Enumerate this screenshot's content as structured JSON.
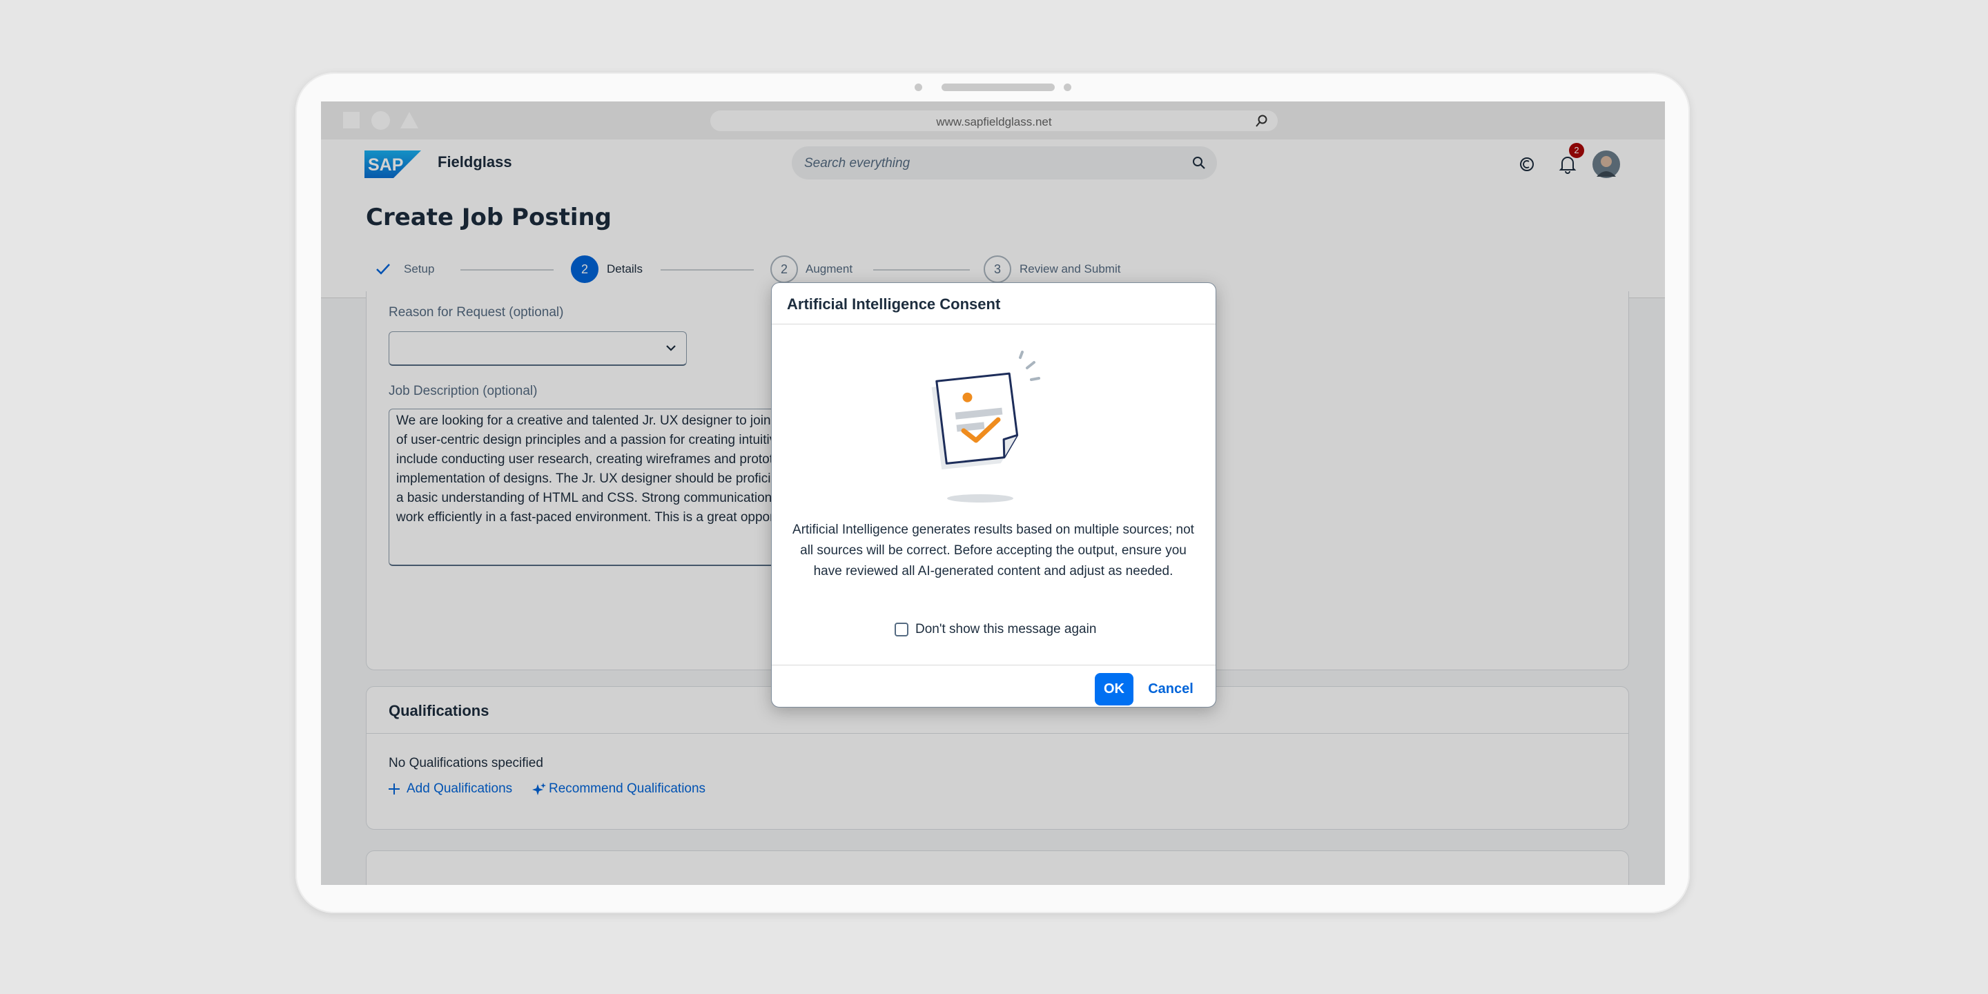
{
  "browser": {
    "url": "www.sapfieldglass.net"
  },
  "app": {
    "logo_text": "SAP",
    "name": "Fieldglass",
    "search_placeholder": "Search everything",
    "notification_count": "2"
  },
  "page": {
    "title": "Create Job Posting",
    "steps": [
      {
        "number": "",
        "label": "Setup",
        "state": "completed"
      },
      {
        "number": "2",
        "label": "Details",
        "state": "current"
      },
      {
        "number": "2",
        "label": "Augment",
        "state": "upcoming"
      },
      {
        "number": "3",
        "label": "Review and Submit",
        "state": "upcoming"
      }
    ]
  },
  "form": {
    "reason_label": "Reason for Request (optional)",
    "reason_value": "",
    "job_description_label": "Job Description (optional)",
    "job_description_lines": [
      "We are looking for a creative and talented Jr. UX designer to join",
      "of user-centric design principles and a passion for creating intuitiv",
      "include conducting user research, creating wireframes and prototy",
      "implementation of designs. The Jr. UX designer should be proficie",
      "a basic understanding of HTML and CSS. Strong communication a",
      "work efficiently in a fast-paced environment. This is a great oppor"
    ]
  },
  "qualifications": {
    "title": "Qualifications",
    "empty_text": "No Qualifications specified",
    "add_link": "Add Qualifications",
    "recommend_link": "Recommend Qualifications"
  },
  "dialog": {
    "title": "Artificial Intelligence Consent",
    "message_lines": [
      "Artificial Intelligence generates results based on multiple sources; not",
      "all sources will be correct. Before accepting the output, ensure you",
      "have reviewed all AI-generated content and adjust as needed."
    ],
    "checkbox_label": "Don't show this message again",
    "checkbox_checked": false,
    "ok_label": "OK",
    "cancel_label": "Cancel"
  },
  "colors": {
    "accent": "#0070f2",
    "brand_blue": "#0a6ed1",
    "illustration_orange": "#ef8c1e",
    "badge_red": "#aa0808"
  }
}
